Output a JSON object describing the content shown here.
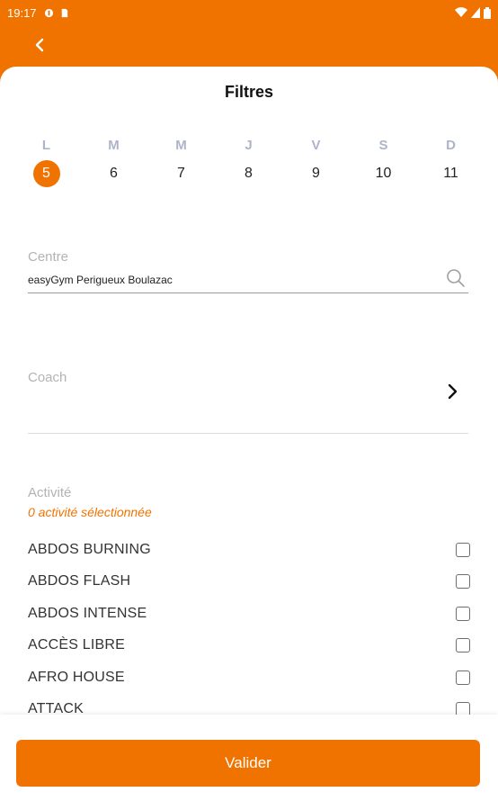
{
  "status_bar": {
    "time": "19:17"
  },
  "header": {
    "title": "Filtres"
  },
  "days": [
    {
      "letter": "L",
      "num": "5",
      "selected": true
    },
    {
      "letter": "M",
      "num": "6",
      "selected": false
    },
    {
      "letter": "M",
      "num": "7",
      "selected": false
    },
    {
      "letter": "J",
      "num": "8",
      "selected": false
    },
    {
      "letter": "V",
      "num": "9",
      "selected": false
    },
    {
      "letter": "S",
      "num": "10",
      "selected": false
    },
    {
      "letter": "D",
      "num": "11",
      "selected": false
    }
  ],
  "centre": {
    "label": "Centre",
    "value": "easyGym Perigueux Boulazac"
  },
  "coach": {
    "label": "Coach"
  },
  "activite": {
    "label": "Activité",
    "count": "0 activité sélectionnée",
    "items": [
      {
        "name": "ABDOS BURNING",
        "checked": false
      },
      {
        "name": "ABDOS FLASH",
        "checked": false
      },
      {
        "name": "ABDOS INTENSE",
        "checked": false
      },
      {
        "name": "ACCÈS LIBRE",
        "checked": false
      },
      {
        "name": "AFRO HOUSE",
        "checked": false
      },
      {
        "name": "ATTACK",
        "checked": false
      }
    ]
  },
  "actions": {
    "validate_label": "Valider"
  },
  "colors": {
    "accent": "#f07300",
    "day_letter": "#aeb4c8",
    "label_gray": "#b3b3b3"
  }
}
